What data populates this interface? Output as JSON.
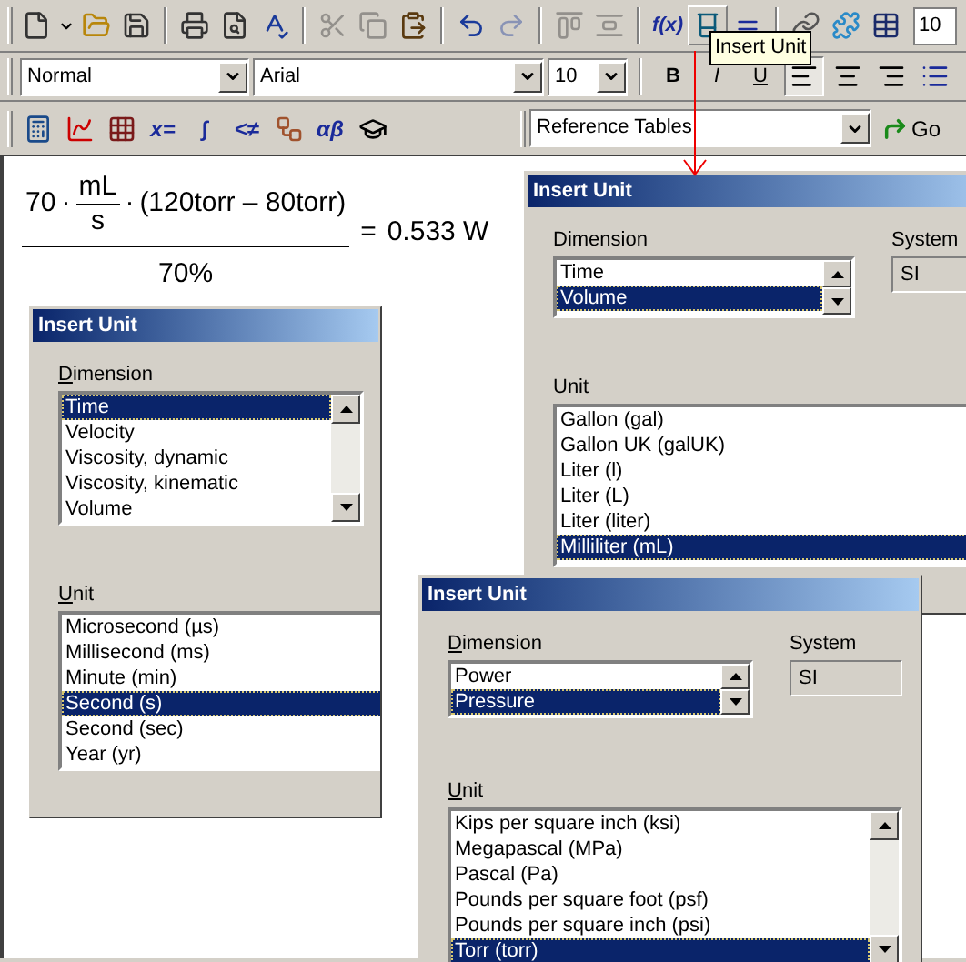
{
  "toolbar_standard": [
    [
      {
        "kind": "new",
        "disabled": false,
        "raised": false
      },
      {
        "kind": "dropdown",
        "disabled": false,
        "raised": false
      },
      {
        "kind": "open",
        "disabled": false,
        "raised": false
      },
      {
        "kind": "save",
        "disabled": false,
        "raised": false
      }
    ],
    [
      {
        "kind": "print",
        "disabled": false,
        "raised": false
      },
      {
        "kind": "preview",
        "disabled": false,
        "raised": false
      },
      {
        "kind": "spelling",
        "disabled": false,
        "raised": false
      }
    ],
    [
      {
        "kind": "cut",
        "disabled": true,
        "raised": false
      },
      {
        "kind": "copy",
        "disabled": true,
        "raised": false
      },
      {
        "kind": "paste",
        "disabled": false,
        "raised": false
      }
    ],
    [
      {
        "kind": "undo",
        "disabled": false,
        "raised": false
      },
      {
        "kind": "redo",
        "disabled": true,
        "raised": false
      }
    ],
    [
      {
        "kind": "align-top",
        "disabled": true,
        "raised": false
      },
      {
        "kind": "align-middle",
        "disabled": true,
        "raised": false
      }
    ],
    [
      {
        "kind": "text",
        "label": "f(x)",
        "disabled": false,
        "raised": false
      },
      {
        "kind": "unit",
        "disabled": false,
        "raised": true
      },
      {
        "kind": "equals",
        "disabled": false,
        "raised": false
      }
    ],
    [
      {
        "kind": "link",
        "disabled": false,
        "raised": false
      },
      {
        "kind": "puzzle",
        "disabled": false,
        "raised": false
      },
      {
        "kind": "table",
        "disabled": false,
        "raised": false
      }
    ]
  ],
  "zoom_box": {
    "value": "10"
  },
  "tooltip": {
    "text": "Insert Unit"
  },
  "toolbar_formatting": {
    "style": "Normal",
    "font": "Arial",
    "size": "10",
    "buttons": [
      {
        "kind": "bold",
        "label": "B",
        "pressed": false
      },
      {
        "kind": "italic",
        "label": "I",
        "pressed": false
      },
      {
        "kind": "underline",
        "label": "U",
        "pressed": false
      },
      {
        "kind": "align-left",
        "pressed": true
      },
      {
        "kind": "align-center",
        "pressed": false
      },
      {
        "kind": "align-right",
        "pressed": false
      },
      {
        "kind": "list",
        "pressed": false
      }
    ]
  },
  "toolbar_math": {
    "buttons": [
      {
        "kind": "calculator"
      },
      {
        "kind": "graph"
      },
      {
        "kind": "matrix"
      },
      {
        "kind": "text",
        "label": "x="
      },
      {
        "kind": "text",
        "label": "∫"
      },
      {
        "kind": "text",
        "label": "<≠"
      },
      {
        "kind": "program"
      },
      {
        "kind": "text",
        "label": "αβ"
      },
      {
        "kind": "cap"
      }
    ],
    "reference": "Reference Tables",
    "go": "Go"
  },
  "formula": {
    "coefficient": "70",
    "dot": "·",
    "unit_numerator": "mL",
    "unit_denominator": "s",
    "dot_2": "·",
    "difference": "(120torr – 80torr)",
    "denominator": "70%",
    "equals": "=",
    "result": "0.533 W"
  },
  "dialogs": [
    {
      "title": "Insert Unit",
      "mnemonic": true,
      "dimension_label": "Dimension",
      "dimension_scrollbar": true,
      "unit_scrollbar": false,
      "dimension_items": [
        {
          "text": "Time",
          "selected": true
        },
        {
          "text": "Velocity",
          "selected": false
        },
        {
          "text": "Viscosity, dynamic",
          "selected": false
        },
        {
          "text": "Viscosity, kinematic",
          "selected": false
        },
        {
          "text": "Volume",
          "selected": false
        }
      ],
      "unit_label": "Unit",
      "unit_items": [
        {
          "text": "Microsecond (µs)",
          "selected": false
        },
        {
          "text": "Millisecond (ms)",
          "selected": false
        },
        {
          "text": "Minute (min)",
          "selected": false
        },
        {
          "text": "Second (s)",
          "selected": true
        },
        {
          "text": "Second (sec)",
          "selected": false
        },
        {
          "text": "Year (yr)",
          "selected": false
        }
      ]
    },
    {
      "title": "Insert Unit",
      "mnemonic": false,
      "dimension_label": "Dimension",
      "dimension_scrollbar": true,
      "unit_scrollbar": false,
      "dimension_items": [
        {
          "text": "Time",
          "selected": false
        },
        {
          "text": "Volume",
          "selected": true
        }
      ],
      "system_label": "System",
      "system_value": "SI",
      "unit_label": "Unit",
      "unit_items": [
        {
          "text": "Gallon (gal)",
          "selected": false
        },
        {
          "text": "Gallon UK (galUK)",
          "selected": false
        },
        {
          "text": "Liter (l)",
          "selected": false
        },
        {
          "text": "Liter (L)",
          "selected": false
        },
        {
          "text": "Liter (liter)",
          "selected": false
        },
        {
          "text": "Milliliter (mL)",
          "selected": true
        }
      ]
    },
    {
      "title": "Insert Unit",
      "mnemonic": true,
      "dimension_label": "Dimension",
      "dimension_scrollbar": true,
      "unit_scrollbar": true,
      "dimension_items": [
        {
          "text": "Power",
          "selected": false
        },
        {
          "text": "Pressure",
          "selected": true
        }
      ],
      "system_label": "System",
      "system_value": "SI",
      "unit_label": "Unit",
      "unit_items": [
        {
          "text": "Kips per square inch (ksi)",
          "selected": false
        },
        {
          "text": "Megapascal (MPa)",
          "selected": false
        },
        {
          "text": "Pascal (Pa)",
          "selected": false
        },
        {
          "text": "Pounds per square foot (psf)",
          "selected": false
        },
        {
          "text": "Pounds per square inch (psi)",
          "selected": false
        },
        {
          "text": "Torr (torr)",
          "selected": true
        }
      ]
    }
  ]
}
